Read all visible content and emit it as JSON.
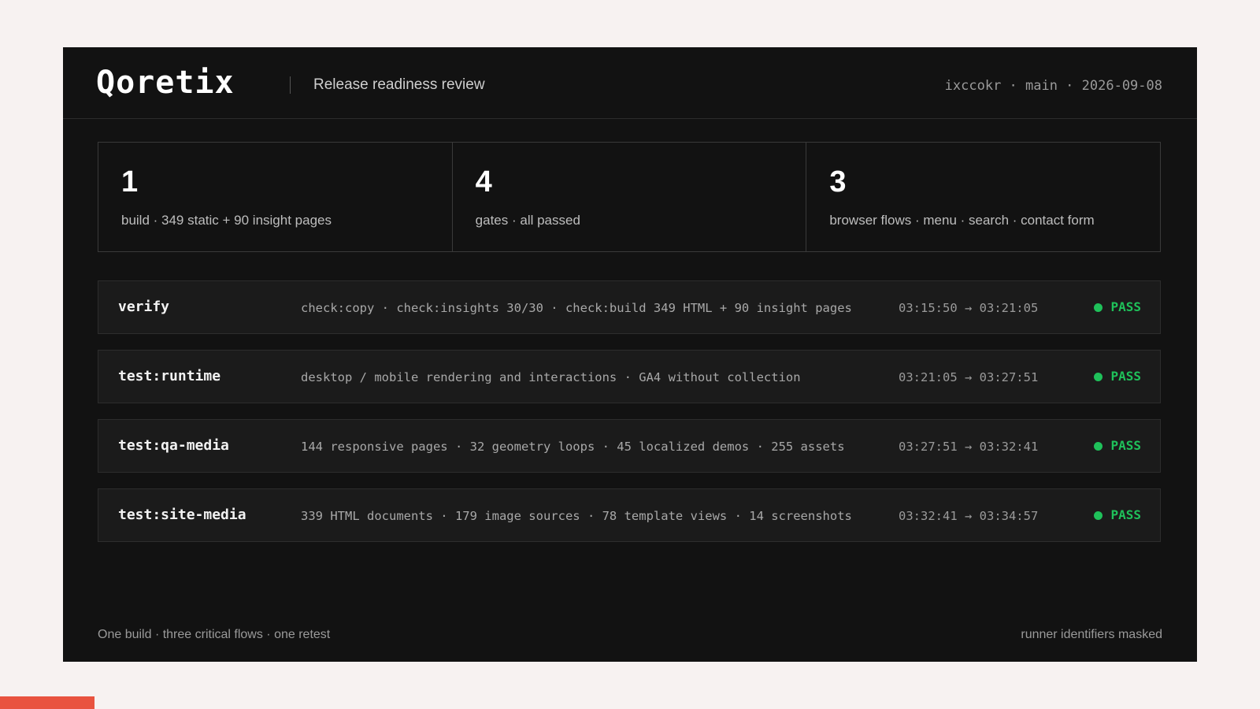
{
  "header": {
    "logo": "Qoretix",
    "subtitle": "Release readiness review",
    "meta": "ixccokr · main · 2026-09-08"
  },
  "stats": [
    {
      "value": "1",
      "label": "build · 349 static + 90 insight pages"
    },
    {
      "value": "4",
      "label": "gates · all passed"
    },
    {
      "value": "3",
      "label": "browser flows · menu · search · contact form"
    }
  ],
  "gates": [
    {
      "name": "verify",
      "details": "check:copy · check:insights 30/30 · check:build 349 HTML + 90 insight pages",
      "time": "03:15:50 → 03:21:05",
      "status": "PASS"
    },
    {
      "name": "test:runtime",
      "details": "desktop / mobile rendering and interactions · GA4 without collection",
      "time": "03:21:05 → 03:27:51",
      "status": "PASS"
    },
    {
      "name": "test:qa-media",
      "details": "144 responsive pages · 32 geometry loops · 45 localized demos · 255 assets",
      "time": "03:27:51 → 03:32:41",
      "status": "PASS"
    },
    {
      "name": "test:site-media",
      "details": "339 HTML documents · 179 image sources · 78 template views · 14 screenshots",
      "time": "03:32:41 → 03:34:57",
      "status": "PASS"
    }
  ],
  "footer": {
    "left": "One build · three critical flows · one retest",
    "right": "runner identifiers masked"
  },
  "colors": {
    "pass": "#1fc15a",
    "accent": "#e9533f",
    "panel": "#121212",
    "page": "#f7f2f1"
  }
}
